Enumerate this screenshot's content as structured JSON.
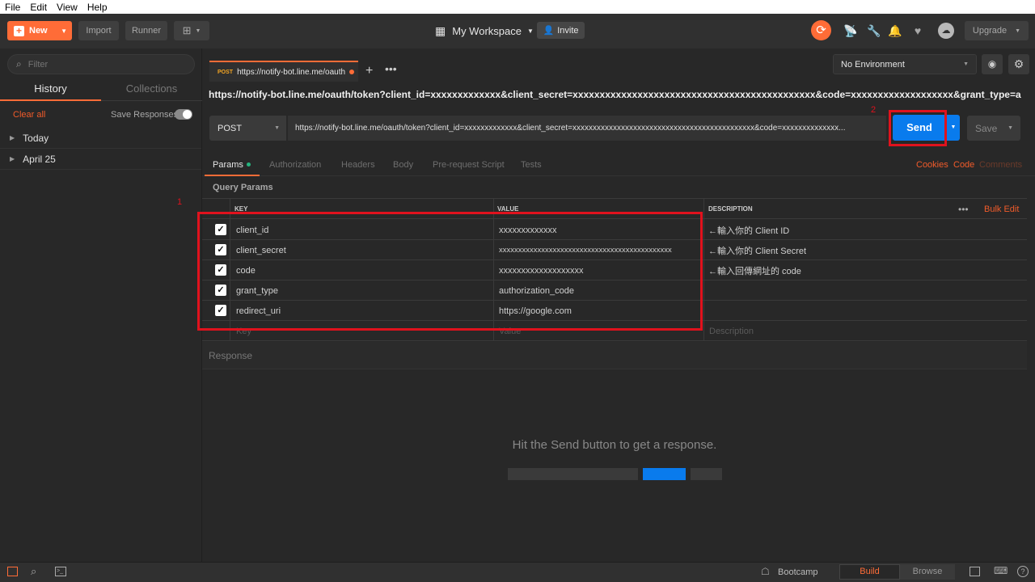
{
  "menubar": {
    "items": [
      "File",
      "Edit",
      "View",
      "Help"
    ]
  },
  "header": {
    "new_label": "New",
    "import_label": "Import",
    "runner_label": "Runner",
    "workspace_label": "My Workspace",
    "invite_label": "Invite",
    "upgrade_label": "Upgrade"
  },
  "sidebar": {
    "filter_placeholder": "Filter",
    "tab_history": "History",
    "tab_collections": "Collections",
    "clear_all": "Clear all",
    "save_responses": "Save Responses",
    "groups": [
      "Today",
      "April 25"
    ]
  },
  "request_tab": {
    "method": "POST",
    "title": "https://notify-bot.line.me/oauth"
  },
  "environment": {
    "label": "No Environment"
  },
  "request": {
    "name": "https://notify-bot.line.me/oauth/token?client_id=xxxxxxxxxxxxx&client_secret=xxxxxxxxxxxxxxxxxxxxxxxxxxxxxxxxxxxxxxxxxxxxx&code=xxxxxxxxxxxxxxxxxxx&grant_type=authorization_co...",
    "method": "POST",
    "url": "https://notify-bot.line.me/oauth/token?client_id=xxxxxxxxxxxxx&client_secret=xxxxxxxxxxxxxxxxxxxxxxxxxxxxxxxxxxxxxxxxxxxxx&code=xxxxxxxxxxxxxx...",
    "send_label": "Send",
    "save_label": "Save"
  },
  "subtabs": [
    "Params",
    "Authorization",
    "Headers",
    "Body",
    "Pre-request Script",
    "Tests"
  ],
  "subtab_links": {
    "cookies": "Cookies",
    "code": "Code",
    "comments": "Comments"
  },
  "params": {
    "section_title": "Query Params",
    "col_key": "KEY",
    "col_value": "VALUE",
    "col_description": "DESCRIPTION",
    "bulk_edit": "Bulk Edit",
    "rows": [
      {
        "key": "client_id",
        "value": "xxxxxxxxxxxxx",
        "description": "←輸入你的 Client ID"
      },
      {
        "key": "client_secret",
        "value": "xxxxxxxxxxxxxxxxxxxxxxxxxxxxxxxxxxxxxxxxxxxxx",
        "description": "←輸入你的 Client Secret"
      },
      {
        "key": "code",
        "value": "xxxxxxxxxxxxxxxxxxx",
        "description": "←輸入回傳網址的 code"
      },
      {
        "key": "grant_type",
        "value": "authorization_code",
        "description": ""
      },
      {
        "key": "redirect_uri",
        "value": "https://google.com",
        "description": ""
      }
    ],
    "placeholder_key": "Key",
    "placeholder_value": "Value",
    "placeholder_description": "Description"
  },
  "annotations": {
    "one": "1",
    "two": "2"
  },
  "response": {
    "title": "Response",
    "hint": "Hit the Send button to get a response."
  },
  "statusbar": {
    "bootcamp": "Bootcamp",
    "build": "Build",
    "browse": "Browse"
  },
  "colors": {
    "accent": "#ff6c37",
    "send_blue": "#097bed",
    "annotation_red": "#e0121d"
  }
}
